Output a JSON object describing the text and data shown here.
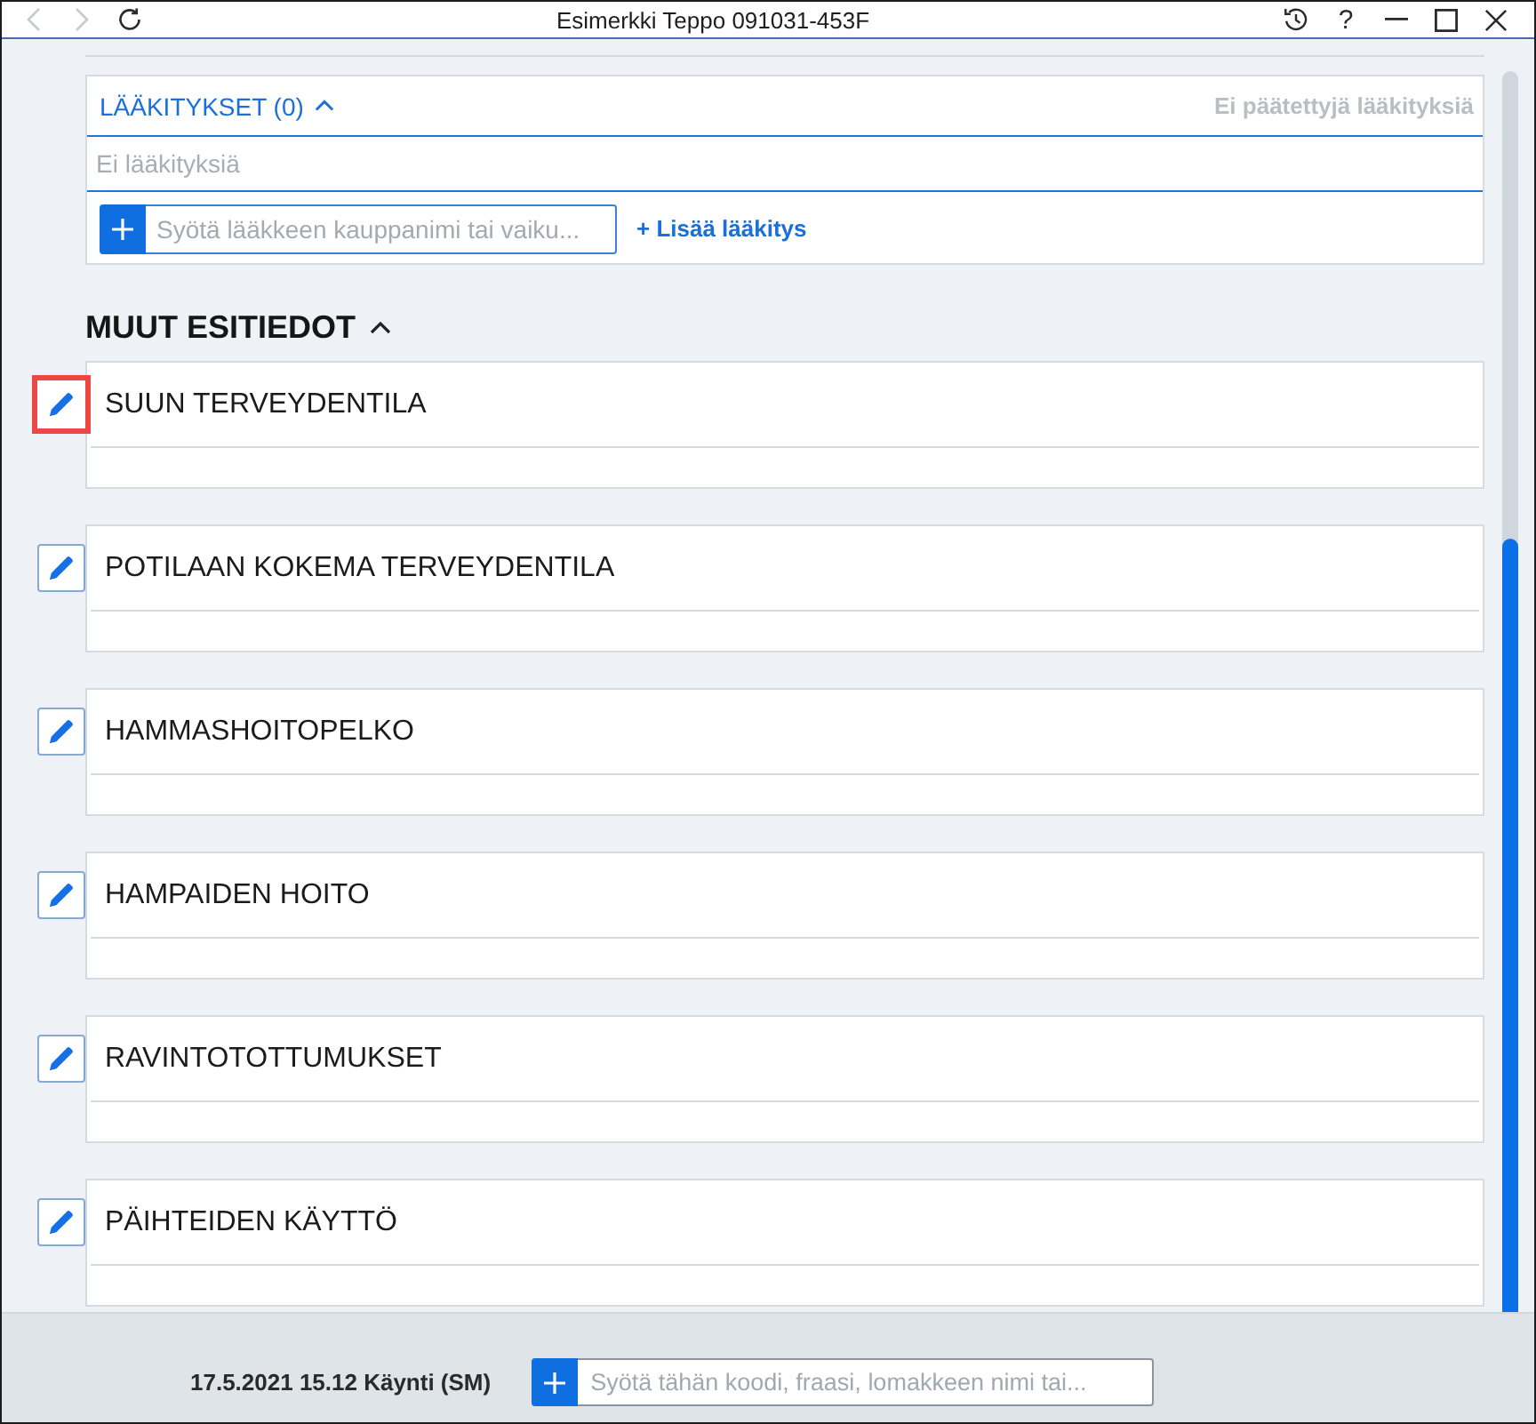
{
  "window": {
    "title": "Esimerkki Teppo 091031-453F",
    "nav_buttons": [
      {
        "kind": "back",
        "disabled": true
      },
      {
        "kind": "forward",
        "disabled": true
      },
      {
        "kind": "reload",
        "disabled": false
      }
    ],
    "controls": [
      {
        "kind": "history"
      },
      {
        "kind": "help",
        "label": "?"
      },
      {
        "kind": "minimize"
      },
      {
        "kind": "maximize"
      },
      {
        "kind": "close"
      }
    ]
  },
  "medications": {
    "title": "LÄÄKITYKSET (0)",
    "expanded": true,
    "ended_note": "Ei päätettyjä lääkityksiä",
    "empty_text": "Ei lääkityksiä",
    "search": {
      "placeholder": "Syötä lääkkeen kauppanimi tai vaiku..."
    },
    "add_link": "+ Lisää lääkitys"
  },
  "other_info": {
    "title": "MUUT ESITIEDOT",
    "expanded": true,
    "sections": [
      {
        "title": "SUUN TERVEYDENTILA",
        "highlighted": true
      },
      {
        "title": "POTILAAN KOKEMA TERVEYDENTILA",
        "highlighted": false
      },
      {
        "title": "HAMMASHOITOPELKO",
        "highlighted": false
      },
      {
        "title": "HAMPAIDEN HOITO",
        "highlighted": false
      },
      {
        "title": "RAVINTOTOTTUMUKSET",
        "highlighted": false
      },
      {
        "title": "PÄIHTEIDEN KÄYTTÖ",
        "highlighted": false
      }
    ]
  },
  "footer": {
    "visit": "17.5.2021 15.12 Käynti (SM)",
    "entry": {
      "placeholder": "Syötä tähän koodi, fraasi, lomakkeen nimi tai..."
    }
  }
}
